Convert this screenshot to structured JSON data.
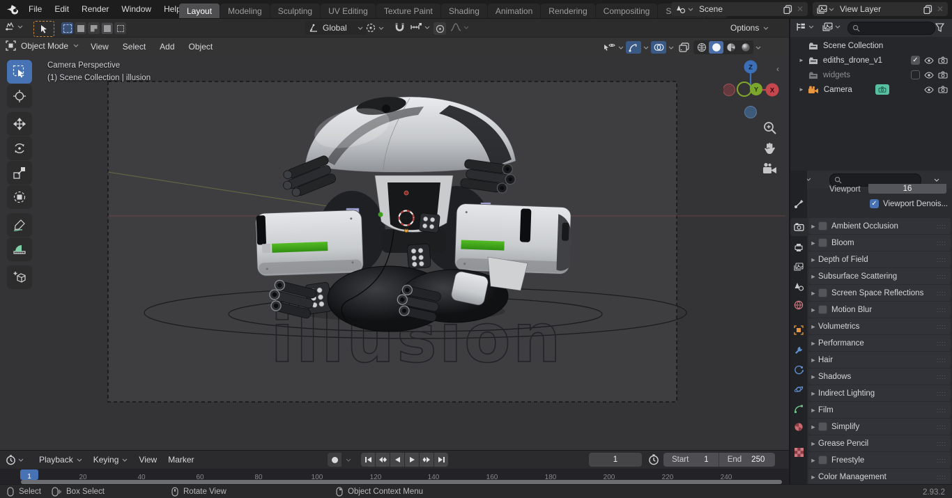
{
  "topbar": {
    "menus": {
      "file": "File",
      "edit": "Edit",
      "render": "Render",
      "window": "Window",
      "help": "Help"
    },
    "tabs": [
      "Layout",
      "Modeling",
      "Sculpting",
      "UV Editing",
      "Texture Paint",
      "Shading",
      "Animation",
      "Rendering",
      "Compositing",
      "Scripting"
    ],
    "add_tab": "+",
    "scene": {
      "label": "Scene"
    },
    "view_layer": {
      "label": "View Layer"
    }
  },
  "tool_settings": {
    "orientation": "Global",
    "options": "Options"
  },
  "viewport": {
    "mode": "Object Mode",
    "menus": {
      "view": "View",
      "select": "Select",
      "add": "Add",
      "object": "Object"
    },
    "overlay": {
      "line1": "Camera Perspective",
      "line2": "(1) Scene Collection | illusion"
    },
    "watermark": "illusion",
    "axes": {
      "z": "Z",
      "x": "X",
      "y": "Y"
    }
  },
  "outliner": {
    "rows": [
      {
        "name": "Scene Collection"
      },
      {
        "name": "ediths_drone_v1"
      },
      {
        "name": "widgets"
      },
      {
        "name": "Camera"
      }
    ]
  },
  "properties": {
    "viewport_field": {
      "label": "Viewport",
      "value": "16"
    },
    "denoise_label": "Viewport Denois...",
    "panels": [
      {
        "label": "Ambient Occlusion"
      },
      {
        "label": "Bloom"
      },
      {
        "label": "Depth of Field"
      },
      {
        "label": "Subsurface Scattering"
      },
      {
        "label": "Screen Space Reflections"
      },
      {
        "label": "Motion Blur"
      },
      {
        "label": "Volumetrics"
      },
      {
        "label": "Performance"
      },
      {
        "label": "Hair"
      },
      {
        "label": "Shadows"
      },
      {
        "label": "Indirect Lighting"
      },
      {
        "label": "Film"
      },
      {
        "label": "Simplify"
      },
      {
        "label": "Grease Pencil"
      },
      {
        "label": "Freestyle"
      },
      {
        "label": "Color Management"
      }
    ],
    "grip": "::::"
  },
  "timeline": {
    "menus": {
      "playback": "Playback",
      "keying": "Keying",
      "view": "View",
      "marker": "Marker"
    },
    "ticks": [
      "20",
      "40",
      "60",
      "80",
      "100",
      "120",
      "140",
      "160",
      "180",
      "200",
      "220",
      "240"
    ],
    "current_frame": "1",
    "frame_field": "1",
    "start_label": "Start",
    "start_value": "1",
    "end_label": "End",
    "end_value": "250"
  },
  "status_bar": {
    "select": "Select",
    "box_select": "Box Select",
    "rotate_view": "Rotate View",
    "context_menu": "Object Context Menu",
    "version": "2.93.2"
  },
  "colors": {
    "accent_blue": "#4772b3",
    "drone_green": "#3f9e1d",
    "axis_x_red": "#c4474d",
    "axis_z_blue": "#3b6fb8",
    "axis_y_green": "#7ba82c",
    "camera_data_badge": "#57c0a2",
    "object_orange": "#e8973f"
  }
}
